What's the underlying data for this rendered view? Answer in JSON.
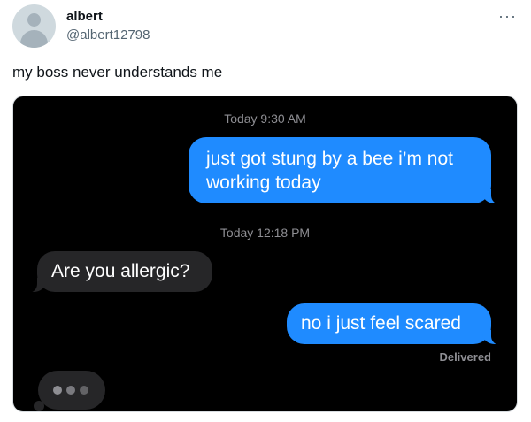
{
  "author": {
    "name": "albert",
    "handle": "@albert12798",
    "avatar_icon": "default-profile-icon"
  },
  "menu_icon_text": "···",
  "tweet": {
    "text": "my boss never understands me"
  },
  "conversation": {
    "timestamp_1": "Today 9:30 AM",
    "message_1": "just got stung by a bee i’m not working today",
    "timestamp_2": "Today 12:18 PM",
    "message_2": "Are you allergic?",
    "message_3": "no i just feel scared",
    "delivered": "Delivered",
    "typing_indicator": "typing-dots-icon"
  },
  "colors": {
    "sent_bubble": "#1f8bff",
    "received_bubble": "#262628",
    "conversation_background": "#000000"
  }
}
